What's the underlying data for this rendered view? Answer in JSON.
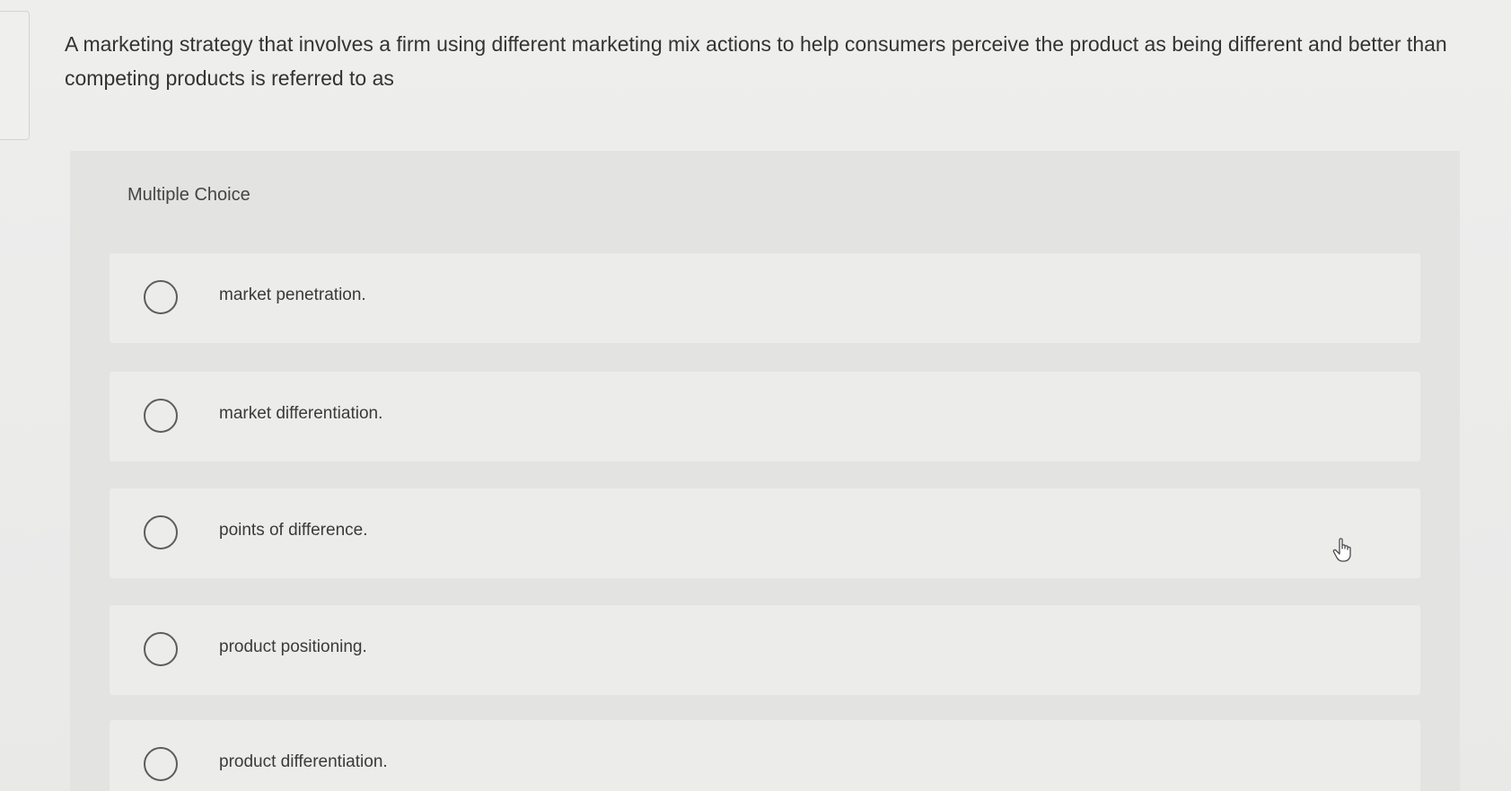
{
  "question": {
    "text": "A marketing strategy that involves a firm using different marketing mix actions to help consumers perceive the product as being different and better than competing products is referred to as"
  },
  "multiple_choice": {
    "label": "Multiple Choice",
    "options": [
      {
        "label": "market penetration."
      },
      {
        "label": "market differentiation."
      },
      {
        "label": "points of difference."
      },
      {
        "label": "product positioning."
      },
      {
        "label": "product differentiation."
      }
    ]
  },
  "icons": {
    "cursor": "hand-pointer-icon",
    "radio": "radio-unselected-icon"
  },
  "colors": {
    "background": "#ebebea",
    "panel": "#e3e3e2",
    "option": "#ececeb",
    "text": "#333333",
    "radio_border": "#5c5c5c"
  }
}
